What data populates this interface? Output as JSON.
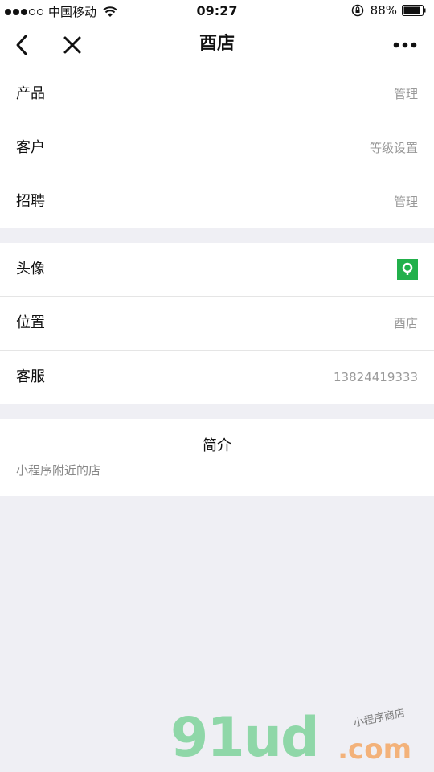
{
  "status_bar": {
    "carrier": "中国移动",
    "time": "09:27",
    "battery": "88%"
  },
  "nav": {
    "title": "酉店"
  },
  "group1": [
    {
      "label": "产品",
      "value": "管理"
    },
    {
      "label": "客户",
      "value": "等级设置"
    },
    {
      "label": "招聘",
      "value": "管理"
    }
  ],
  "group2": [
    {
      "label": "头像"
    },
    {
      "label": "位置",
      "value": "酉店"
    },
    {
      "label": "客服",
      "value": "13824419333"
    }
  ],
  "intro": {
    "title": "简介",
    "text": "小程序附近的店"
  },
  "watermark": {
    "main": "91ud",
    "domain": ".com",
    "tagline": "小程序商店"
  },
  "colors": {
    "avatar": "#22b04b",
    "background": "#efeff4"
  }
}
